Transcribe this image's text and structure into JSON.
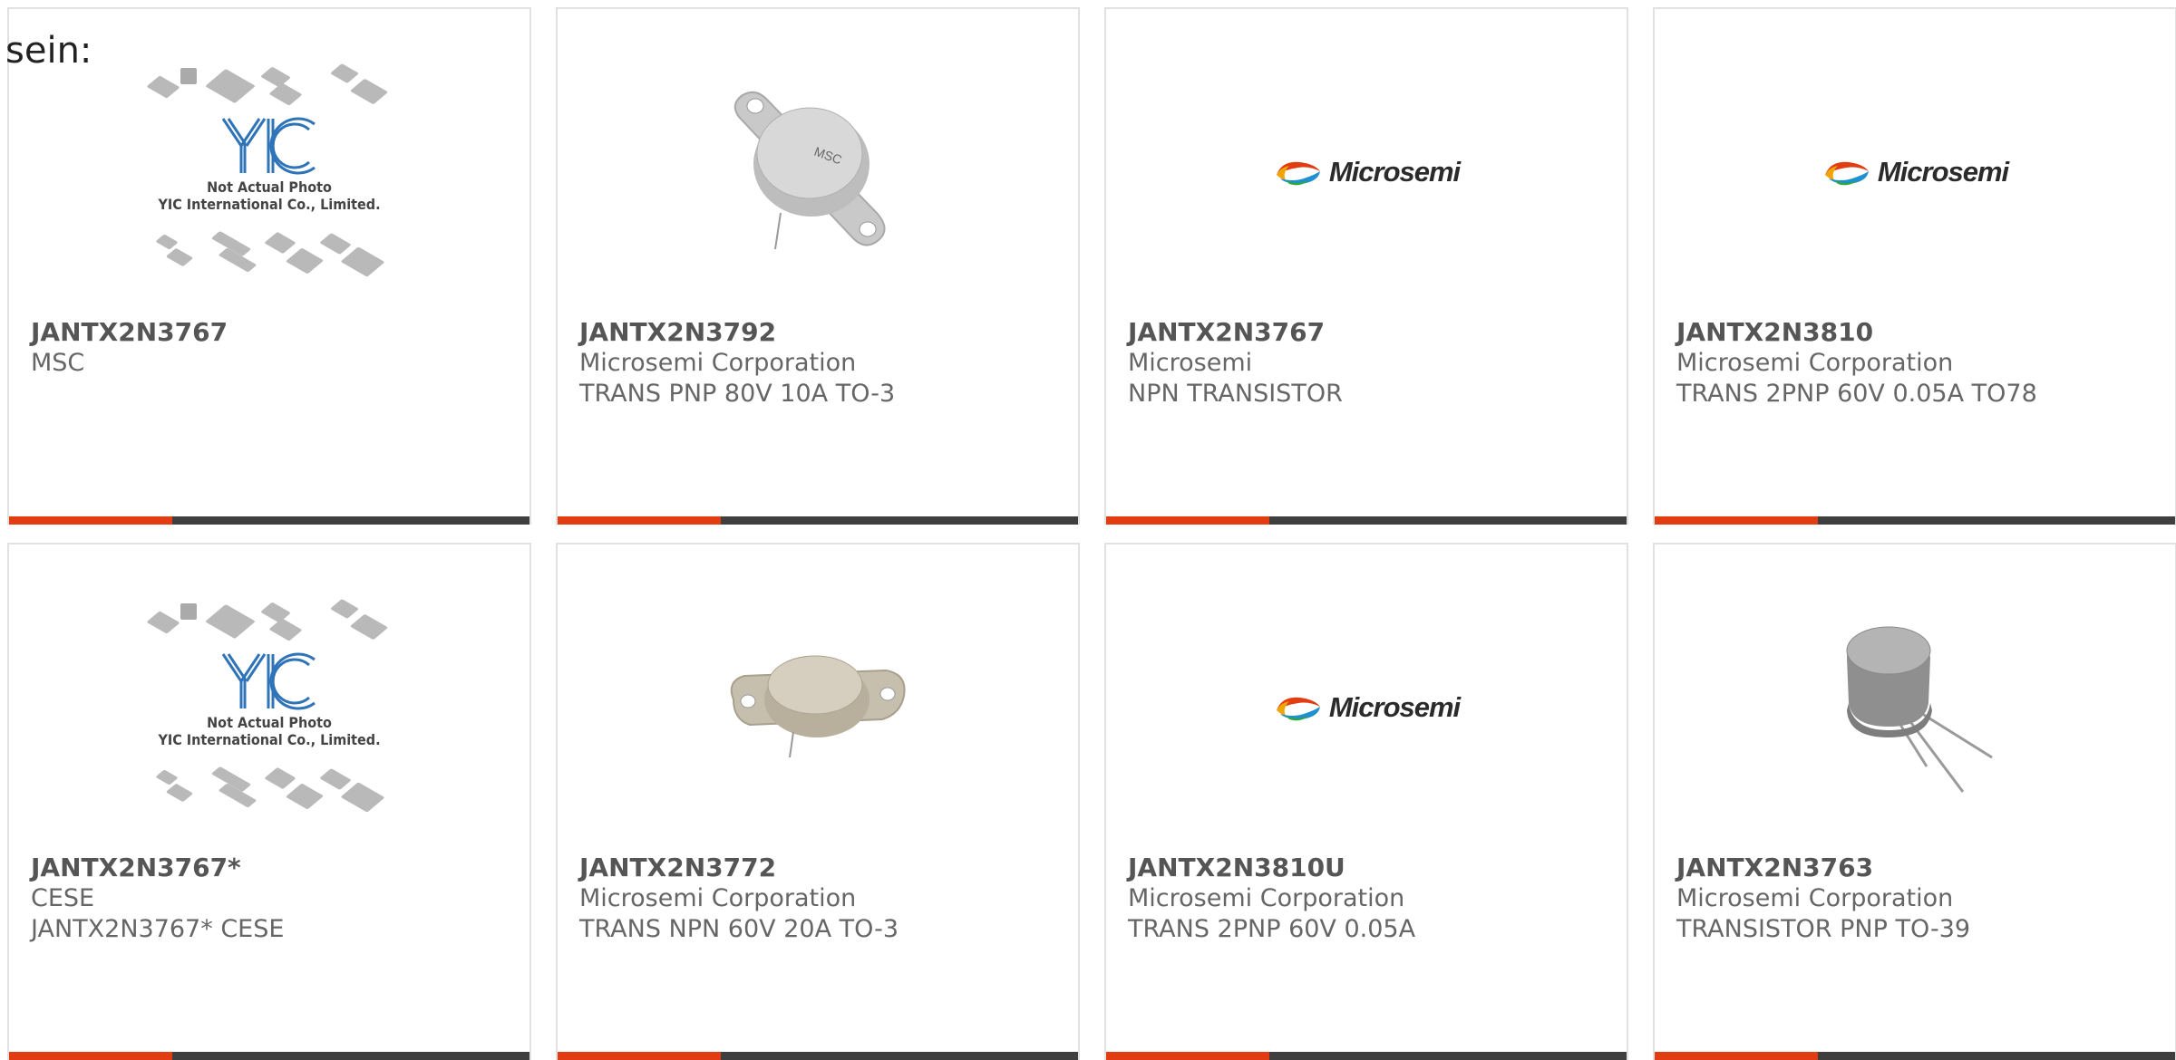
{
  "intro_text": "sein:",
  "placeholder": {
    "line1": "Not Actual Photo",
    "line2": "YIC International Co., Limited."
  },
  "cards": [
    {
      "part": "JANTX2N3767",
      "manufacturer": "MSC",
      "description": "",
      "image": "yic-placeholder"
    },
    {
      "part": "JANTX2N3792",
      "manufacturer": "Microsemi Corporation",
      "description": "TRANS PNP 80V 10A TO-3",
      "image": "to3-msc"
    },
    {
      "part": "JANTX2N3767",
      "manufacturer": "Microsemi",
      "description": "NPN TRANSISTOR",
      "image": "microsemi-logo"
    },
    {
      "part": "JANTX2N3810",
      "manufacturer": "Microsemi Corporation",
      "description": "TRANS 2PNP 60V 0.05A TO78",
      "image": "microsemi-logo"
    },
    {
      "part": "JANTX2N3767*",
      "manufacturer": "CESE",
      "description": "JANTX2N3767* CESE",
      "image": "yic-placeholder"
    },
    {
      "part": "JANTX2N3772",
      "manufacturer": "Microsemi Corporation",
      "description": "TRANS NPN 60V 20A TO-3",
      "image": "to3"
    },
    {
      "part": "JANTX2N3810U",
      "manufacturer": "Microsemi Corporation",
      "description": "TRANS 2PNP 60V 0.05A",
      "image": "microsemi-logo"
    },
    {
      "part": "JANTX2N3763",
      "manufacturer": "Microsemi Corporation",
      "description": "TRANSISTOR PNP TO-39",
      "image": "to39"
    }
  ],
  "logo_text": "Microsemi",
  "to3_marking": "MSC",
  "colors": {
    "accent_red": "#e23d12",
    "accent_dark": "#3f3f3f",
    "border": "#e1e1e1",
    "text": "#555555"
  }
}
